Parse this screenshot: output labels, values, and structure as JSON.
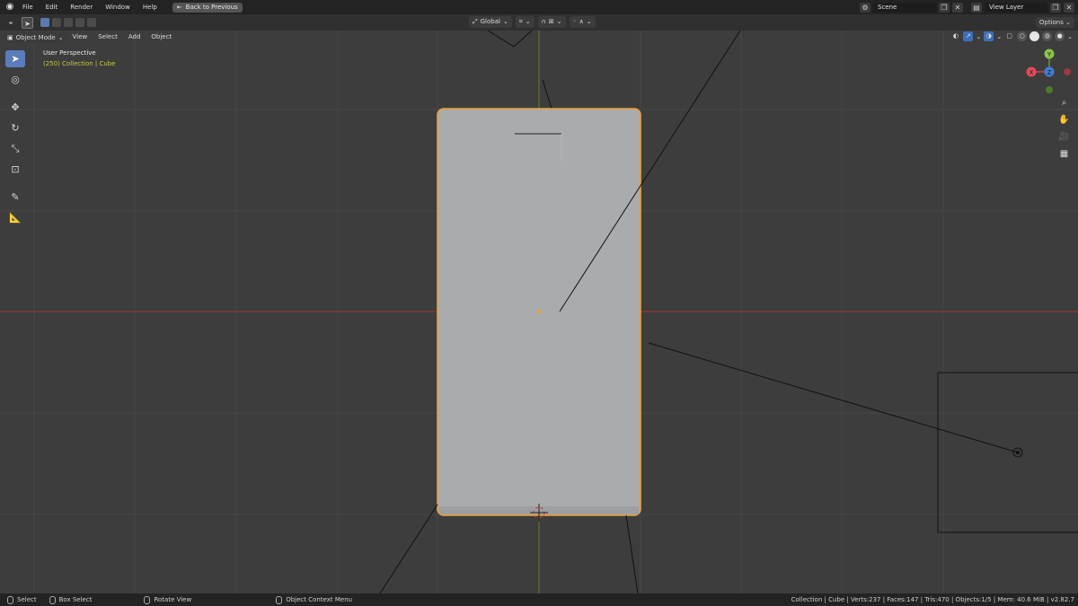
{
  "menu": {
    "items": [
      "File",
      "Edit",
      "Render",
      "Window",
      "Help"
    ],
    "back_label": "Back to Previous",
    "scene_label": "Scene",
    "view_layer_label": "View Layer"
  },
  "tool_header": {
    "orientation": "Global",
    "options_label": "Options"
  },
  "view_header": {
    "mode": "Object Mode",
    "menus": [
      "View",
      "Select",
      "Add",
      "Object"
    ]
  },
  "viewport": {
    "perspective_label": "User Perspective",
    "collection_label": "(250) Collection | Cube",
    "gizmo": {
      "y": "Y",
      "x": "X",
      "z": "Z"
    }
  },
  "toolbar": {
    "tools": [
      "select-box",
      "cursor",
      "move",
      "rotate",
      "scale",
      "transform",
      "annotate",
      "measure"
    ]
  },
  "status": {
    "select": "Select",
    "box_select": "Box Select",
    "rotate_view": "Rotate View",
    "context_menu": "Object Context Menu",
    "stats": "Collection | Cube | Verts:237 | Faces:147 | Tris:470 | Objects:1/5 | Mem: 40.6 MiB | v2.82.7"
  },
  "colors": {
    "accent": "#5b7dbd",
    "selection_outline": "#f0a030",
    "x_axis": "#c84646",
    "y_axis": "#6a9a2e",
    "z_axis": "#3f7fd8",
    "collection_text": "#c8c84a"
  }
}
